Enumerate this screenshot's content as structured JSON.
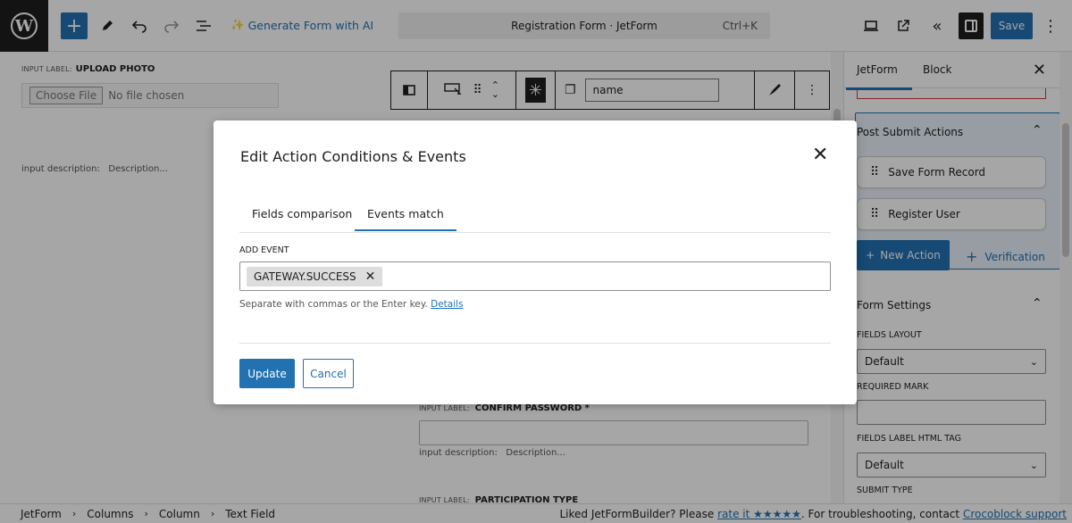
{
  "toolbar": {
    "generate_ai": "Generate Form with AI",
    "doc_title": "Registration Form · JetForm",
    "shortcut": "Ctrl+K",
    "save": "Save"
  },
  "canvas": {
    "upload": {
      "small": "INPUT LABEL:",
      "label": "UPLOAD PHOTO",
      "choose": "Choose File",
      "nofile": "No file chosen",
      "desc_label": "input description:",
      "desc_value": "Description..."
    },
    "block_name": "name",
    "confirm": {
      "small": "INPUT LABEL:",
      "label": "CONFIRM PASSWORD *",
      "desc_label": "input description:",
      "desc_value": "Description..."
    },
    "participation": {
      "small": "INPUT LABEL:",
      "label": "PARTICIPATION TYPE"
    }
  },
  "sidebar": {
    "tabs": [
      "JetForm",
      "Block"
    ],
    "post_submit_title": "Post Submit Actions",
    "actions": [
      "Save Form Record",
      "Register User"
    ],
    "new_action": "New Action",
    "verification": "Verification",
    "form_settings_title": "Form Settings",
    "fields_layout_label": "FIELDS LAYOUT",
    "fields_layout_value": "Default",
    "required_mark_label": "REQUIRED MARK",
    "label_tag_label": "FIELDS LABEL HTML TAG",
    "label_tag_value": "Default",
    "submit_type_label": "SUBMIT TYPE"
  },
  "footer": {
    "breadcrumb": [
      "JetForm",
      "Columns",
      "Column",
      "Text Field"
    ],
    "note_prefix": "Liked JetFormBuilder? Please",
    "rate_link": "rate it ★★★★★",
    "note_middle": ". For troubleshooting, contact",
    "support_link": "Crocoblock support"
  },
  "modal": {
    "title": "Edit Action Conditions & Events",
    "tabs": [
      "Fields comparison",
      "Events match"
    ],
    "active_tab": "Events match",
    "add_event_label": "ADD EVENT",
    "token": "GATEWAY.SUCCESS",
    "help_text": "Separate with commas or the Enter key.",
    "help_link": "Details",
    "update": "Update",
    "cancel": "Cancel"
  },
  "colors": {
    "accent": "#2271b1",
    "dark": "#1e1e1e",
    "error": "#d63638"
  }
}
